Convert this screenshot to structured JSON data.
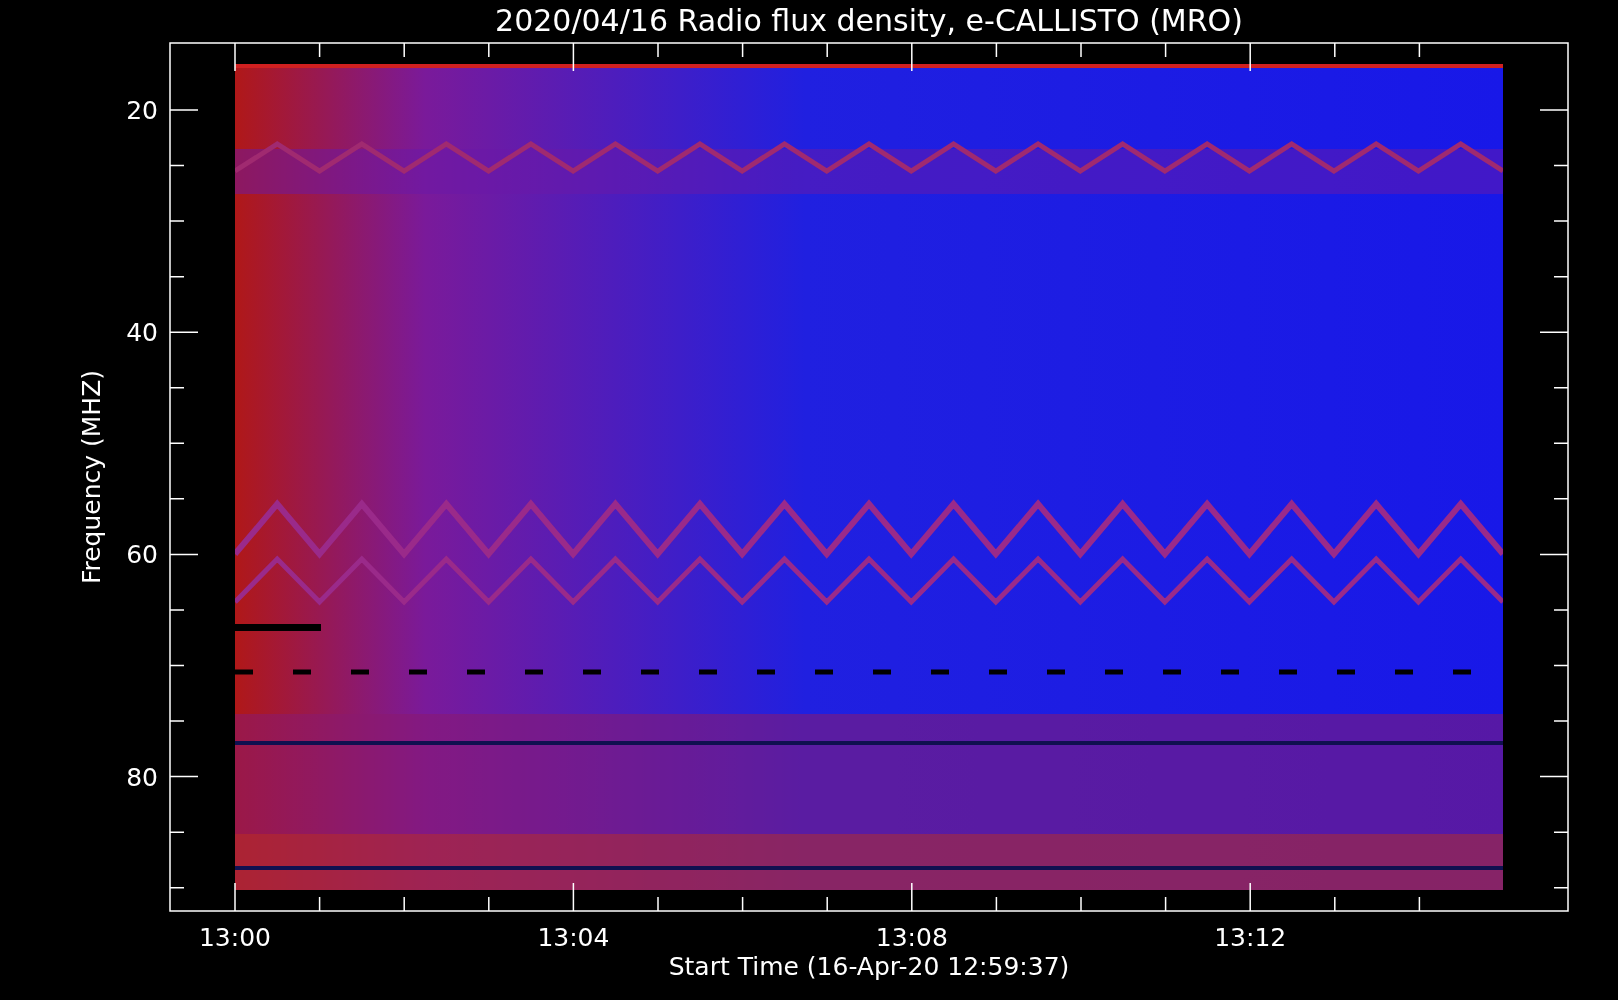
{
  "title": "2020/04/16  Radio flux density, e-CALLISTO (MRO)",
  "y_axis": {
    "label": "Frequency (MHZ)",
    "ticks": [
      "20",
      "40",
      "60",
      "80"
    ]
  },
  "x_axis": {
    "label": "Start Time (16-Apr-20 12:59:37)",
    "ticks": [
      "13:00",
      "13:04",
      "13:08",
      "13:12"
    ]
  }
}
